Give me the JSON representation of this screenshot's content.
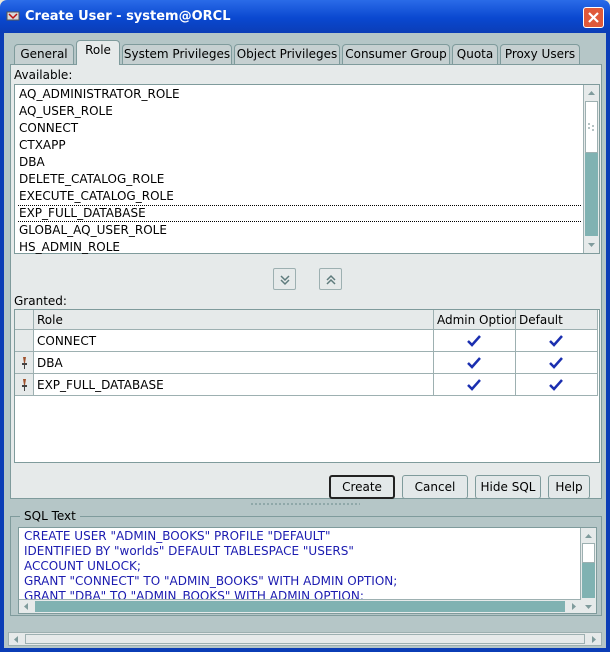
{
  "window": {
    "title": "Create User - system@ORCL"
  },
  "tabs": [
    {
      "label": "General"
    },
    {
      "label": "Role"
    },
    {
      "label": "System Privileges"
    },
    {
      "label": "Object Privileges"
    },
    {
      "label": "Consumer Group"
    },
    {
      "label": "Quota"
    },
    {
      "label": "Proxy Users"
    }
  ],
  "active_tab": "Role",
  "available": {
    "label": "Available:",
    "items": [
      "AQ_ADMINISTRATOR_ROLE",
      "AQ_USER_ROLE",
      "CONNECT",
      "CTXAPP",
      "DBA",
      "DELETE_CATALOG_ROLE",
      "EXECUTE_CATALOG_ROLE",
      "EXP_FULL_DATABASE",
      "GLOBAL_AQ_USER_ROLE",
      "HS_ADMIN_ROLE"
    ],
    "focused_item": "EXP_FULL_DATABASE"
  },
  "granted": {
    "label": "Granted:",
    "columns": [
      "Role",
      "Admin Option",
      "Default"
    ],
    "rows": [
      {
        "role": "CONNECT",
        "admin_option": true,
        "default": true
      },
      {
        "role": "DBA",
        "admin_option": true,
        "default": true
      },
      {
        "role": "EXP_FULL_DATABASE",
        "admin_option": true,
        "default": true
      }
    ]
  },
  "buttons": {
    "create": "Create",
    "cancel": "Cancel",
    "hide_sql": "Hide SQL",
    "help": "Help"
  },
  "sql": {
    "label": "SQL Text",
    "lines": [
      "CREATE USER \"ADMIN_BOOKS\"  PROFILE \"DEFAULT\"",
      "   IDENTIFIED BY \"worlds\" DEFAULT TABLESPACE \"USERS\"",
      "   ACCOUNT UNLOCK;",
      "GRANT \"CONNECT\" TO \"ADMIN_BOOKS\" WITH ADMIN OPTION;",
      "GRANT \"DBA\" TO \"ADMIN_BOOKS\" WITH ADMIN OPTION;"
    ]
  },
  "colors": {
    "titlebar": "#0A48D0",
    "check": "#1B2FB0",
    "sql_keyword": "#1B1BB0"
  }
}
